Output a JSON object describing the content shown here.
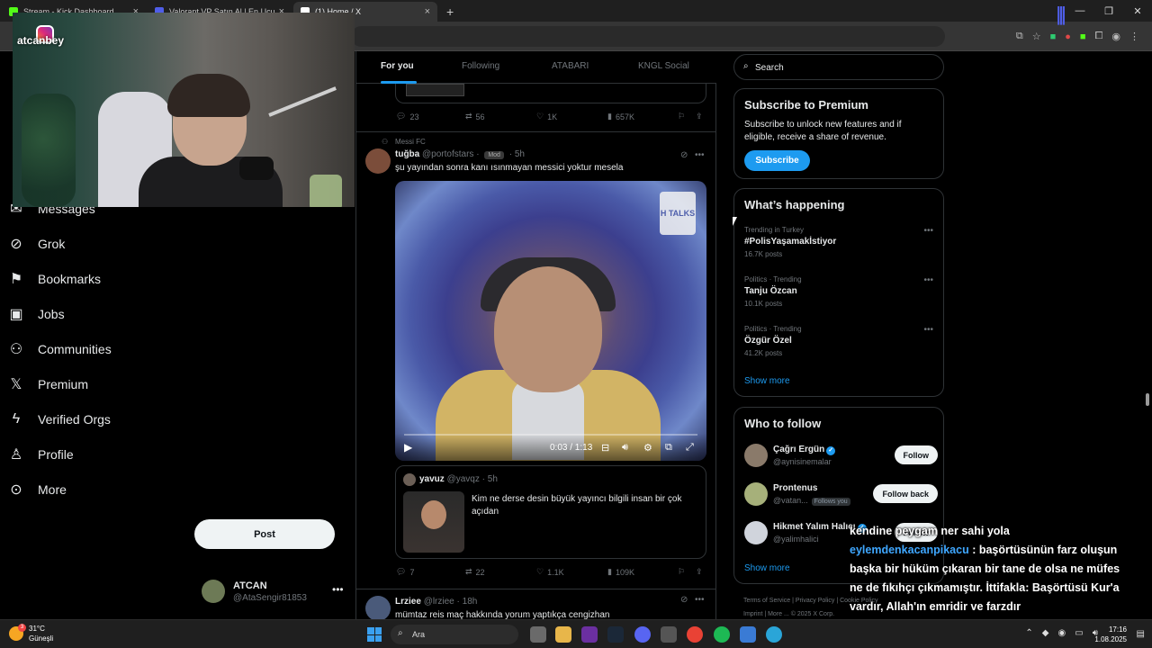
{
  "browser": {
    "tabs": [
      {
        "title": "Stream - Kick Dashboard",
        "color": "#53fc18"
      },
      {
        "title": "Valorant VP Satın Al | En Ucuz V",
        "color": "#4f5ee8"
      },
      {
        "title": "(1) Home / X",
        "color": "#ffffff",
        "active": true
      }
    ],
    "new_tab": "+"
  },
  "webcam": {
    "handle": "atcanbey"
  },
  "nav": {
    "items": [
      {
        "label": "Messages",
        "icon": "mail-icon"
      },
      {
        "label": "Grok",
        "icon": "grok-icon"
      },
      {
        "label": "Bookmarks",
        "icon": "bookmark-icon"
      },
      {
        "label": "Jobs",
        "icon": "briefcase-icon"
      },
      {
        "label": "Communities",
        "icon": "people-icon"
      },
      {
        "label": "Premium",
        "icon": "x-logo-icon"
      },
      {
        "label": "Verified Orgs",
        "icon": "lightning-icon"
      },
      {
        "label": "Profile",
        "icon": "person-icon"
      },
      {
        "label": "More",
        "icon": "more-circle-icon"
      }
    ],
    "post_label": "Post",
    "account": {
      "name": "ATCAN",
      "handle": "@AtaSengir81853"
    }
  },
  "feed": {
    "tabs": [
      "For you",
      "Following",
      "ATABARI",
      "KNGL Social"
    ],
    "prev_tweet_actions": {
      "replies": "23",
      "reposts": "56",
      "likes": "1K",
      "views": "657K"
    },
    "tweet": {
      "context": "Messi FC",
      "name": "tuğba",
      "handle": "@portofstars",
      "badge": "Mod",
      "time": "5h",
      "text": "şu yayından sonra kanı ısınmayan messici yoktur mesela",
      "video": {
        "time": "0:03 / 1:13",
        "logo_text": "H TALKS"
      },
      "quote": {
        "name": "yavuz",
        "handle": "@yavqz",
        "time": "5h",
        "text": "Kim ne derse desin büyük yayıncı bilgili insan bir çok açıdan"
      },
      "actions": {
        "replies": "7",
        "reposts": "22",
        "likes": "1.1K",
        "views": "109K"
      }
    },
    "next_tweet": {
      "name": "Lrziee",
      "handle": "@lrziee",
      "time": "18h",
      "text": "mümtaz reis maç hakkında yorum yaptıkça cengizhan"
    }
  },
  "sidebar": {
    "search_placeholder": "Search",
    "premium": {
      "title": "Subscribe to Premium",
      "desc": "Subscribe to unlock new features and if eligible, receive a share of revenue.",
      "button": "Subscribe"
    },
    "happening": {
      "title": "What’s happening",
      "trends": [
        {
          "context": "Trending in Turkey",
          "name": "#PolisYaşamakİstiyor",
          "posts": "16.7K posts"
        },
        {
          "context": "Politics · Trending",
          "name": "Tanju Özcan",
          "posts": "10.1K posts"
        },
        {
          "context": "Politics · Trending",
          "name": "Özgür Özel",
          "posts": "41.2K posts"
        }
      ],
      "show_more": "Show more"
    },
    "who_to_follow": {
      "title": "Who to follow",
      "users": [
        {
          "name": "Çağrı Ergün",
          "handle": "@aynisinemalar",
          "verified": true,
          "button": "Follow",
          "follows_you": ""
        },
        {
          "name": "Prontenus",
          "handle": "@vatan...",
          "verified": false,
          "button": "Follow back",
          "follows_you": "Follows you"
        },
        {
          "name": "Hikmet Yalım Halıcı",
          "handle": "@yalimhalici",
          "verified": true,
          "button": "Follow",
          "follows_you": ""
        }
      ],
      "show_more": "Show more"
    },
    "footer": {
      "line1": "Terms of Service  |  Privacy Policy  |  Cookie Policy",
      "line2": "Imprint  |  More ...  © 2025 X Corp."
    }
  },
  "chat": {
    "line0": "kendine peygam ner sahi yola",
    "user": "eylemdenkacanpikacu",
    "line1": " : başörtüsünün farz oluşun",
    "line2": "başka bir hüküm çıkaran bir tane de olsa ne müfes",
    "line3": "ne de fıkıhçı çıkmamıştır. İttifakla: Başörtüsü Kur'a",
    "line4": "vardır, Allah'ın emridir ve farzdır"
  },
  "taskbar": {
    "weather_temp": "31°C",
    "weather_desc": "Güneşli",
    "weather_badge": "3",
    "search": "Ara",
    "time": "17:16",
    "date": "1.08.2025"
  }
}
